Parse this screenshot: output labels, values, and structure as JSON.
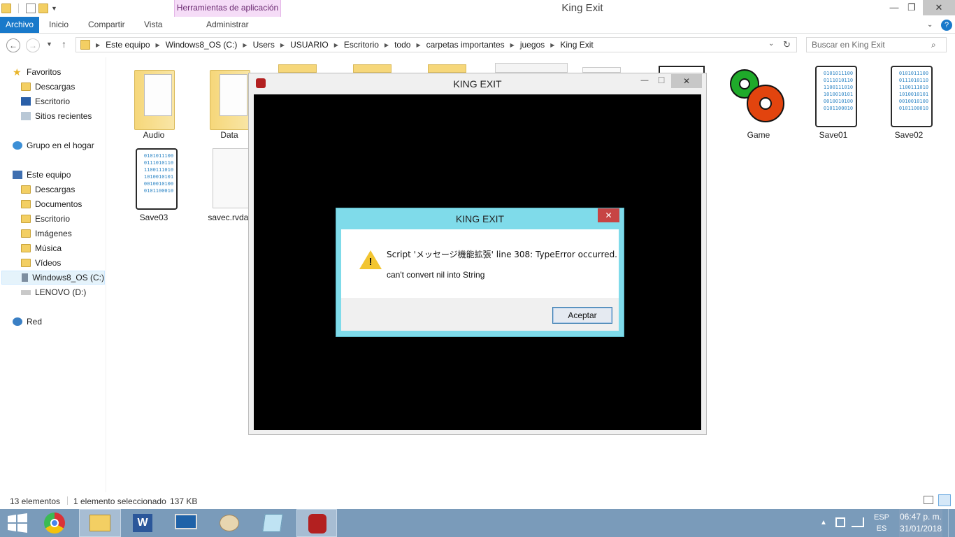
{
  "window": {
    "title": "King Exit",
    "context_tab": "Herramientas de aplicación",
    "minimize": "—",
    "maximize": "❐",
    "close": "✕"
  },
  "ribbon": {
    "tabs": [
      "Archivo",
      "Inicio",
      "Compartir",
      "Vista",
      "Administrar"
    ]
  },
  "address": {
    "crumbs": [
      "Este equipo",
      "Windows8_OS (C:)",
      "Users",
      "USUARIO",
      "Escritorio",
      "todo",
      "carpetas importantes",
      "juegos",
      "King Exit"
    ],
    "search_placeholder": "Buscar en King Exit"
  },
  "nav": {
    "favoritos": "Favoritos",
    "fav_items": [
      "Descargas",
      "Escritorio",
      "Sitios recientes"
    ],
    "grupo": "Grupo en el hogar",
    "equipo": "Este equipo",
    "equipo_items": [
      "Descargas",
      "Documentos",
      "Escritorio",
      "Imágenes",
      "Música",
      "Vídeos",
      "Windows8_OS (C:)",
      "LENOVO (D:)"
    ],
    "red": "Red"
  },
  "files": {
    "audio": "Audio",
    "data": "Data",
    "game": "Game",
    "save01": "Save01",
    "save02": "Save02",
    "save03": "Save03",
    "savec": "savec.rvdat",
    "binary_text": "0101011100\n0111010110\n1100111010\n1010010101\n0010010100\n0101100010"
  },
  "game_window": {
    "title": "KING EXIT",
    "min": "—",
    "max": "☐",
    "close": "✕"
  },
  "dialog": {
    "title": "KING EXIT",
    "close": "✕",
    "line1": "Script 'メッセージ機能拡張' line 308: TypeError occurred.",
    "line2": "can't convert nil into String",
    "ok": "Aceptar"
  },
  "status": {
    "count": "13 elementos",
    "selected": "1 elemento seleccionado",
    "size": "137 KB"
  },
  "taskbar": {
    "lang1": "ESP",
    "lang2": "ES",
    "time": "06:47 p. m.",
    "date": "31/01/2018"
  },
  "colors": {
    "accent": "#1979ca",
    "dialog_frame": "#7fdbea",
    "taskbar": "#7a9bba"
  }
}
